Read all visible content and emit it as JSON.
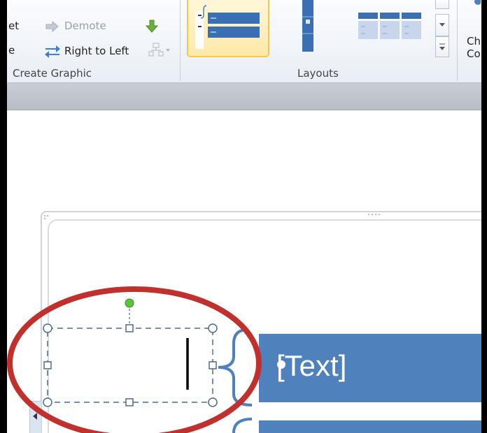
{
  "ribbon": {
    "create_graphic": {
      "add_bullet_label": "et",
      "demote_label": "Demote",
      "right_to_left_label": "Right to Left",
      "left_edge_label": "e",
      "group_label": "Create Graphic"
    },
    "layouts": {
      "group_label": "Layouts"
    },
    "right_edge": {
      "label_line1": "Ch",
      "label_line2": "Co"
    }
  },
  "slide": {
    "row1_text": "[Text]"
  },
  "colors": {
    "smartart_blue": "#4f81bd",
    "annotation_red": "#c0302c",
    "rotate_handle_green": "#5cc23a",
    "selected_layout_border": "#f2c94c"
  }
}
